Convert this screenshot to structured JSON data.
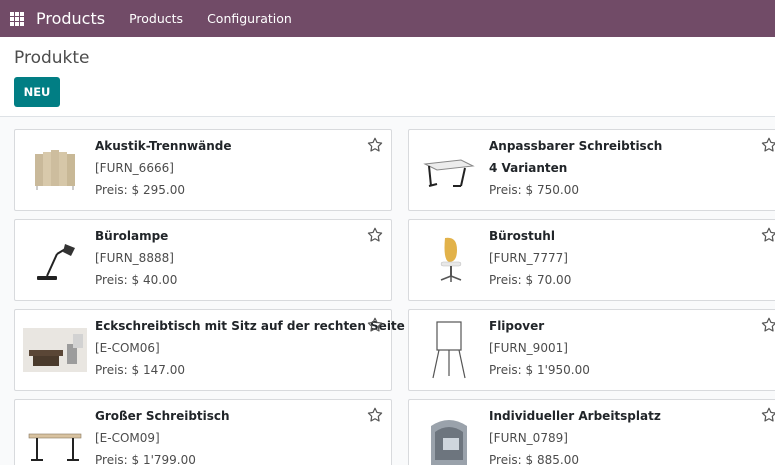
{
  "navbar": {
    "app_name": "Products",
    "menus": [
      "Products",
      "Configuration"
    ]
  },
  "control_panel": {
    "title": "Produkte",
    "new_button": "NEU"
  },
  "products": [
    {
      "name": "Akustik-Trennwände",
      "line2": "[FURN_6666]",
      "price": "Preis: $ 295.00",
      "icon": "acoustic-panel-image"
    },
    {
      "name": "Anpassbarer Schreibtisch",
      "line2": "4 Varianten",
      "price": "Preis: $ 750.00",
      "icon": "desk-image"
    },
    {
      "name": "Bürolampe",
      "line2": "[FURN_8888]",
      "price": "Preis: $ 40.00",
      "icon": "lamp-image"
    },
    {
      "name": "Bürostuhl",
      "line2": "[FURN_7777]",
      "price": "Preis: $ 70.00",
      "icon": "chair-image"
    },
    {
      "name": "Eckschreibtisch mit Sitz auf der rechten Seite",
      "line2": "[E-COM06]",
      "price": "Preis: $ 147.00",
      "icon": "corner-desk-image"
    },
    {
      "name": "Flipover",
      "line2": "[FURN_9001]",
      "price": "Preis: $ 1'950.00",
      "icon": "flipchart-image"
    },
    {
      "name": "Großer Schreibtisch",
      "line2": "[E-COM09]",
      "price": "Preis: $ 1'799.00",
      "icon": "large-desk-image"
    },
    {
      "name": "Individueller Arbeitsplatz",
      "line2": "[FURN_0789]",
      "price": "Preis: $ 885.00",
      "icon": "workstation-image"
    }
  ],
  "colors": {
    "brand": "#714b67",
    "primary_button": "#017e84"
  }
}
